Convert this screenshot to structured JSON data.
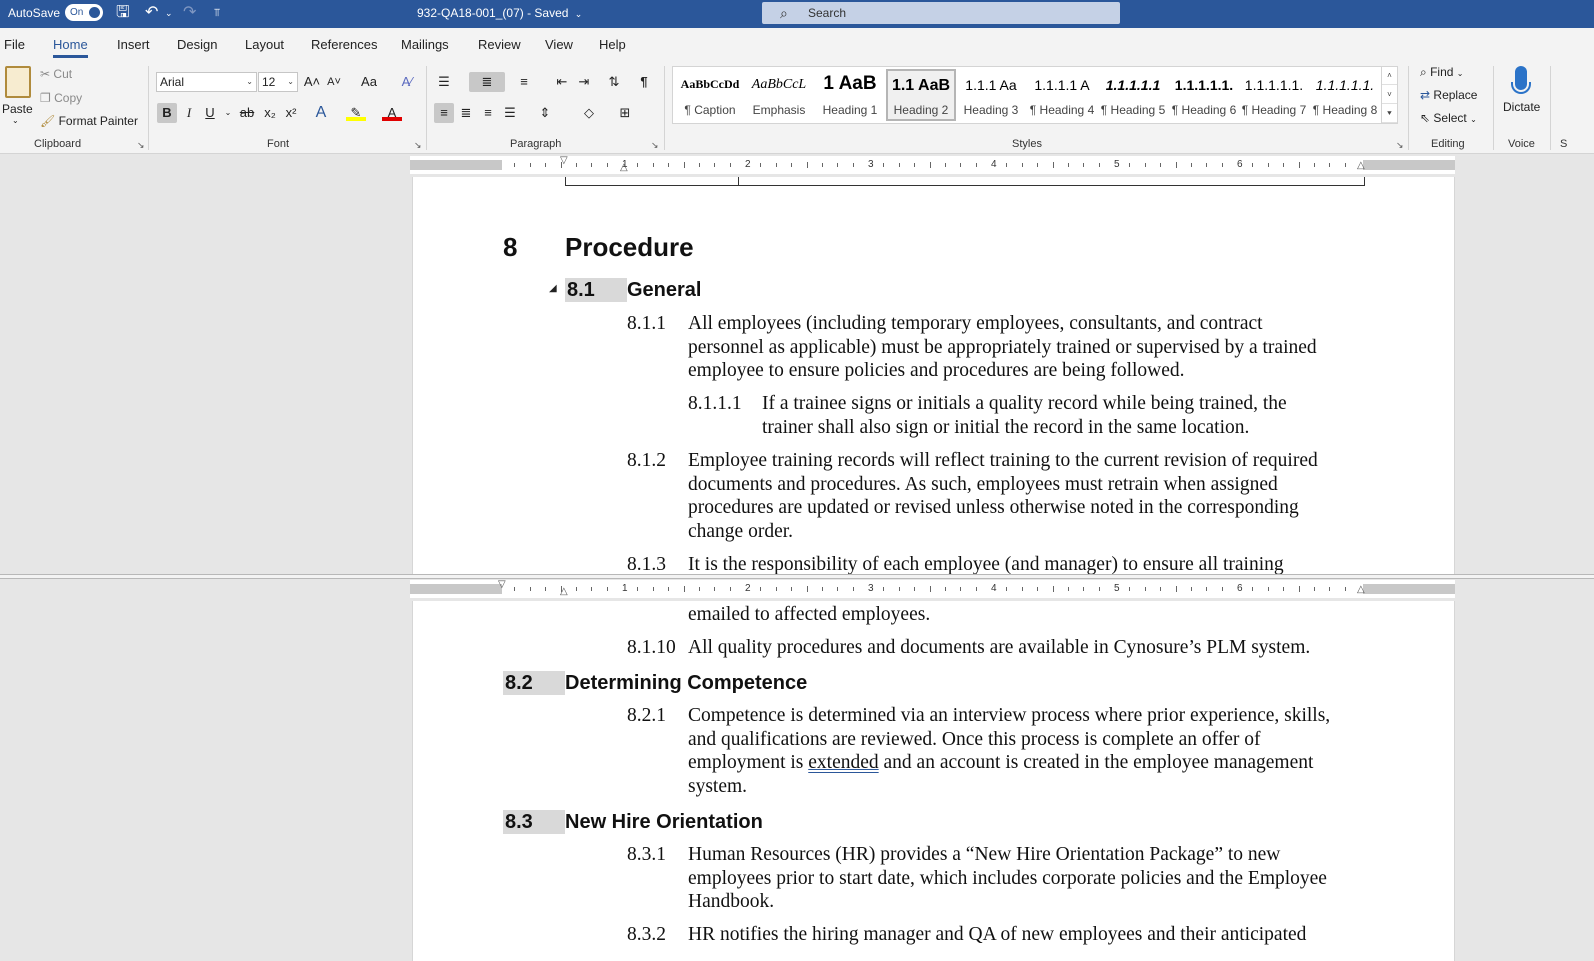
{
  "titlebar": {
    "autosave_label": "AutoSave",
    "autosave_state": "On",
    "doc_title": "932-QA18-001_(07)  -  Saved",
    "search_placeholder": "Search"
  },
  "menu": {
    "tabs": [
      "File",
      "Home",
      "Insert",
      "Design",
      "Layout",
      "References",
      "Mailings",
      "Review",
      "View",
      "Help"
    ],
    "active": "Home"
  },
  "ribbon": {
    "clipboard": {
      "label": "Clipboard",
      "paste": "Paste",
      "cut": "Cut",
      "copy": "Copy",
      "format_painter": "Format Painter"
    },
    "font": {
      "label": "Font",
      "font_name": "Arial",
      "font_size": "12",
      "change_case": "Aa"
    },
    "paragraph": {
      "label": "Paragraph"
    },
    "styles": {
      "label": "Styles",
      "items": [
        {
          "sample": "AaBbCcDd",
          "name": "¶ Caption"
        },
        {
          "sample": "AaBbCcL",
          "name": "Emphasis"
        },
        {
          "sample": "1  AaB",
          "name": "Heading 1"
        },
        {
          "sample": "1.1  AaB",
          "name": "Heading 2"
        },
        {
          "sample": "1.1.1  Aa",
          "name": "Heading 3"
        },
        {
          "sample": "1.1.1.1  A",
          "name": "¶ Heading 4"
        },
        {
          "sample": "1.1.1.1.1",
          "name": "¶ Heading 5"
        },
        {
          "sample": "1.1.1.1.1.",
          "name": "¶ Heading 6"
        },
        {
          "sample": "1.1.1.1.1.",
          "name": "¶ Heading 7"
        },
        {
          "sample": "1.1.1.1.1.",
          "name": "¶ Heading 8"
        }
      ],
      "selected_index": 3
    },
    "editing": {
      "label": "Editing",
      "find": "Find",
      "replace": "Replace",
      "select": "Select"
    },
    "voice": {
      "label": "Voice",
      "dictate": "Dictate"
    },
    "cutoff_label": "S"
  },
  "ruler": {
    "numbers": [
      "1",
      "2",
      "3",
      "4",
      "5",
      "6"
    ]
  },
  "document": {
    "top": {
      "h1_num": "8",
      "h1_text": "Procedure",
      "s81_num": "8.1",
      "s81_text": "General",
      "p811_num": "8.1.1",
      "p811_lines": [
        "All employees (including temporary employees, consultants, and contract",
        "personnel as applicable) must be appropriately trained or supervised by a trained",
        "employee to ensure policies and procedures are being followed."
      ],
      "p8111_num": "8.1.1.1",
      "p8111_lines": [
        "If a trainee signs or initials a quality record while being trained, the",
        "trainer shall also sign or initial the record in the same location."
      ],
      "p812_num": "8.1.2",
      "p812_lines": [
        "Employee training records will reflect training to the current revision of required",
        "documents and procedures. As such, employees must retrain when assigned",
        "procedures are updated or revised unless otherwise noted in the corresponding",
        "change order."
      ],
      "p813_num": "8.1.3",
      "p813_line": "It is the responsibility of each employee (and manager) to ensure all training"
    },
    "bottom": {
      "cont_line": "emailed to affected employees.",
      "p8110_num": "8.1.10",
      "p8110_line": "All quality procedures and documents are available in Cynosure’s PLM system.",
      "s82_num": "8.2",
      "s82_text": "Determining Competence",
      "p821_num": "8.2.1",
      "p821_line1": "Competence is determined via an interview process where prior experience, skills,",
      "p821_line2": "and qualifications are reviewed. Once this process is complete an offer of",
      "p821_line3_a": "employment is ",
      "p821_line3_b": "extended",
      "p821_line3_c": " and an account is created in the employee management",
      "p821_line4": "system.",
      "s83_num": "8.3",
      "s83_text": "New Hire Orientation",
      "p831_num": "8.3.1",
      "p831_lines": [
        "Human Resources (HR) provides a “New Hire Orientation Package” to new",
        "employees prior to start date, which includes corporate policies and the Employee",
        "Handbook."
      ],
      "p832_num": "8.3.2",
      "p832_line": "HR notifies the hiring manager and QA of new employees and their anticipated"
    }
  }
}
